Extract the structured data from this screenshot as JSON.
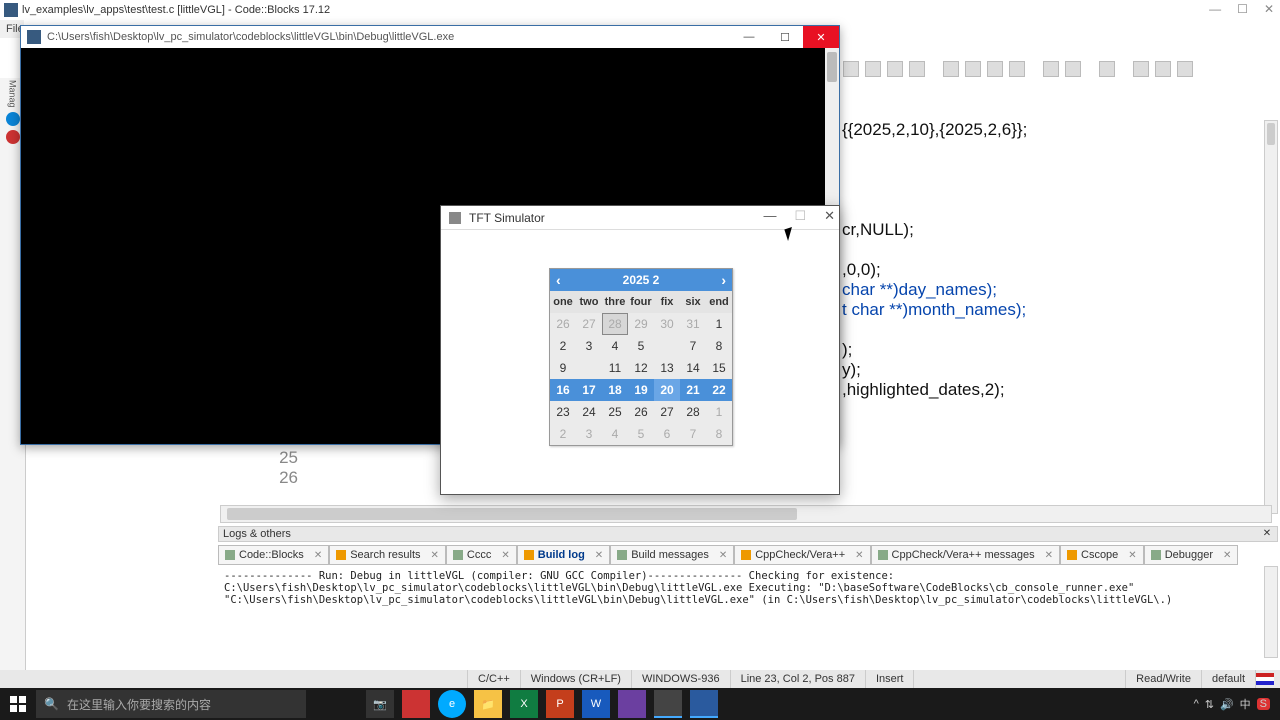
{
  "codeblocks": {
    "title": "lv_examples\\lv_apps\\test\\test.c [littleVGL] - Code::Blocks 17.12",
    "menu": "File",
    "gutter": [
      "25",
      "26"
    ],
    "code_lines": [
      "{{2025,2,10},{2025,2,6}};",
      "",
      "",
      "",
      "",
      "cr,NULL);",
      "",
      ",0,0);",
      "char **)day_names);",
      "t char **)month_names);",
      "",
      ");",
      "y);",
      ",highlighted_dates,2);"
    ]
  },
  "console": {
    "title": "C:\\Users\\fish\\Desktop\\lv_pc_simulator\\codeblocks\\littleVGL\\bin\\Debug\\littleVGL.exe"
  },
  "tft": {
    "title": "TFT Simulator"
  },
  "calendar": {
    "header": "2025 2",
    "day_names": [
      "one",
      "two",
      "thre",
      "four",
      "fix",
      "six",
      "end"
    ],
    "rows": [
      [
        {
          "d": "26",
          "out": true
        },
        {
          "d": "27",
          "out": true
        },
        {
          "d": "28",
          "out": true,
          "cur": true
        },
        {
          "d": "29",
          "out": true
        },
        {
          "d": "30",
          "out": true
        },
        {
          "d": "31",
          "out": true
        },
        {
          "d": "1"
        }
      ],
      [
        {
          "d": "2"
        },
        {
          "d": "3"
        },
        {
          "d": "4"
        },
        {
          "d": "5"
        },
        {
          "d": ""
        },
        {
          "d": "7"
        },
        {
          "d": "8"
        }
      ],
      [
        {
          "d": "9"
        },
        {
          "d": ""
        },
        {
          "d": "11"
        },
        {
          "d": "12"
        },
        {
          "d": "13"
        },
        {
          "d": "14"
        },
        {
          "d": "15"
        }
      ],
      [
        {
          "d": "16",
          "hl": true
        },
        {
          "d": "17",
          "hl": true
        },
        {
          "d": "18",
          "hl": true
        },
        {
          "d": "19",
          "hl": true
        },
        {
          "d": "20",
          "today": true
        },
        {
          "d": "21",
          "hl": true
        },
        {
          "d": "22",
          "hl": true
        }
      ],
      [
        {
          "d": "23"
        },
        {
          "d": "24"
        },
        {
          "d": "25"
        },
        {
          "d": "26"
        },
        {
          "d": "27"
        },
        {
          "d": "28"
        },
        {
          "d": "1",
          "out": true
        }
      ],
      [
        {
          "d": "2",
          "out": true
        },
        {
          "d": "3",
          "out": true
        },
        {
          "d": "4",
          "out": true
        },
        {
          "d": "5",
          "out": true
        },
        {
          "d": "6",
          "out": true
        },
        {
          "d": "7",
          "out": true
        },
        {
          "d": "8",
          "out": true
        }
      ]
    ]
  },
  "logs": {
    "header": "Logs & others",
    "tabs": [
      "Code::Blocks",
      "Search results",
      "Cccc",
      "Build log",
      "Build messages",
      "CppCheck/Vera++",
      "CppCheck/Vera++ messages",
      "Cscope",
      "Debugger"
    ],
    "active_tab": 3,
    "lines": [
      "",
      "-------------- Run: Debug in littleVGL (compiler: GNU GCC Compiler)---------------",
      "",
      "Checking for existence: C:\\Users\\fish\\Desktop\\lv_pc_simulator\\codeblocks\\littleVGL\\bin\\Debug\\littleVGL.exe",
      "Executing: \"D:\\baseSoftware\\CodeBlocks\\cb_console_runner.exe\" \"C:\\Users\\fish\\Desktop\\lv_pc_simulator\\codeblocks\\littleVGL\\bin\\Debug\\littleVGL.exe\"  (in C:\\Users\\fish\\Desktop\\lv_pc_simulator\\codeblocks\\littleVGL\\.)"
    ]
  },
  "status": {
    "lang": "C/C++",
    "eol": "Windows (CR+LF)",
    "enc": "WINDOWS-936",
    "pos": "Line 23, Col 2, Pos 887",
    "ins": "Insert",
    "rw": "Read/Write",
    "profile": "default"
  },
  "taskbar": {
    "search_placeholder": "在这里输入你要搜索的内容"
  }
}
